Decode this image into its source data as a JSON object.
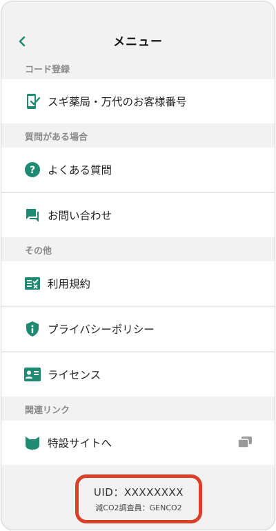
{
  "header": {
    "title": "メニュー",
    "back_icon": "chevron-left-icon"
  },
  "accent_color": "#1f8a72",
  "sections": [
    {
      "label": "コード登録"
    },
    {
      "label": "質問がある場合"
    },
    {
      "label": "その他"
    },
    {
      "label": "関連リンク"
    }
  ],
  "items": {
    "member_number": {
      "label": "スギ薬局・万代のお客様番号",
      "icon": "phone-check-icon"
    },
    "faq": {
      "label": "よくある質問",
      "icon": "question-circle-icon"
    },
    "contact": {
      "label": "お問い合わせ",
      "icon": "chat-bubble-icon"
    },
    "terms": {
      "label": "利用規約",
      "icon": "checklist-icon"
    },
    "privacy": {
      "label": "プライバシーポリシー",
      "icon": "shield-info-icon"
    },
    "license": {
      "label": "ライセンス",
      "icon": "id-card-icon"
    },
    "special_site": {
      "label": "特設サイトへ",
      "icon": "cat-face-icon",
      "external_icon": "external-link-icon"
    }
  },
  "footer": {
    "uid": "UID：XXXXXXXX",
    "staff": "減CO2調査員：GENCO2"
  }
}
